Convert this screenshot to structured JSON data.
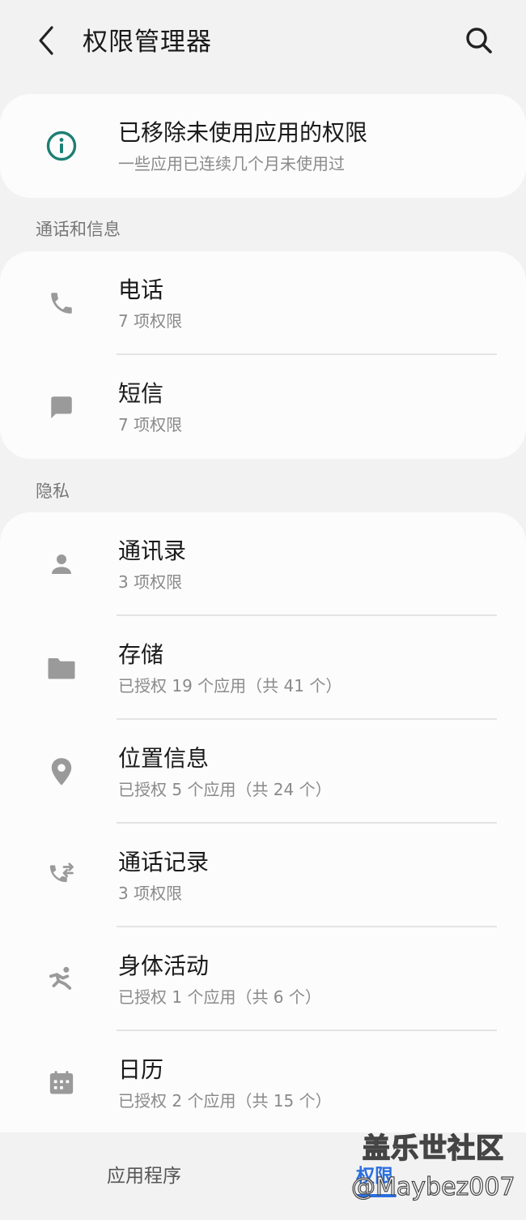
{
  "header": {
    "title": "权限管理器"
  },
  "banner": {
    "title": "已移除未使用应用的权限",
    "subtitle": "一些应用已连续几个月未使用过"
  },
  "sections": {
    "calls": {
      "label": "通话和信息",
      "items": [
        {
          "title": "电话",
          "sub": "7 项权限"
        },
        {
          "title": "短信",
          "sub": "7 项权限"
        }
      ]
    },
    "privacy": {
      "label": "隐私",
      "items": [
        {
          "title": "通讯录",
          "sub": "3 项权限"
        },
        {
          "title": "存储",
          "sub": "已授权 19 个应用（共 41 个）"
        },
        {
          "title": "位置信息",
          "sub": "已授权 5 个应用（共 24 个）"
        },
        {
          "title": "通话记录",
          "sub": "3 项权限"
        },
        {
          "title": "身体活动",
          "sub": "已授权 1 个应用（共 6 个）"
        },
        {
          "title": "日历",
          "sub": "已授权 2 个应用（共 15 个）"
        }
      ]
    }
  },
  "tabs": {
    "apps": "应用程序",
    "permissions": "权限"
  },
  "watermark": {
    "site": "盖乐世社区",
    "handle": "@Maybez007"
  },
  "colors": {
    "accent": "#2a6fe0",
    "info_icon": "#1e7f74",
    "icon_gray": "#9a9a9a"
  }
}
